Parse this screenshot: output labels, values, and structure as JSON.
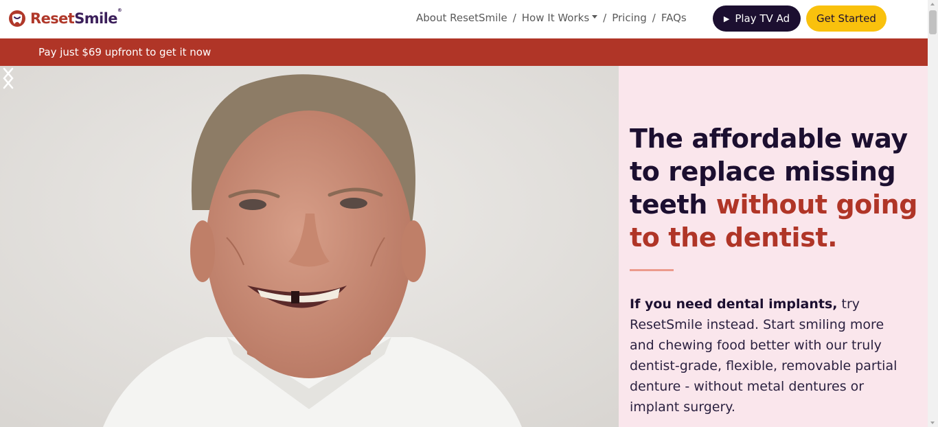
{
  "header": {
    "logo": {
      "reset": "Reset",
      "smile": "Smile",
      "registered": "®"
    },
    "nav": [
      {
        "label": "About ResetSmile",
        "has_dropdown": false
      },
      {
        "label": "How It Works",
        "has_dropdown": true
      },
      {
        "label": "Pricing",
        "has_dropdown": false
      },
      {
        "label": "FAQs",
        "has_dropdown": false
      }
    ],
    "nav_separator": "/",
    "play_button": {
      "icon": "▶",
      "label": "Play TV Ad"
    },
    "cta_button": {
      "label": "Get Started"
    }
  },
  "promo_bar": {
    "text": "Pay just $69 upfront to get it now"
  },
  "hero": {
    "headline_part1": "The affordable way to replace missing teeth",
    "headline_accent": "without going to the dentist.",
    "body_bold": "If you need dental implants,",
    "body_rest": "try ResetSmile instead. Start smiling more and chewing food better with our truly dentist-grade, flexible, removable partial denture - without metal dentures or implant surgery."
  },
  "colors": {
    "brand_red": "#b03527",
    "brand_purple": "#1c0f30",
    "cta_yellow": "#f9c10d",
    "hero_panel_pink": "#fae6ec",
    "divider_pink": "#ec9a8c"
  },
  "icons": {
    "logo": "tooth-smile-logo-icon",
    "play": "play-icon",
    "dropdown": "caret-down-icon",
    "carousel_prev": "chevron-left-icon",
    "carousel_next": "chevron-right-icon"
  }
}
